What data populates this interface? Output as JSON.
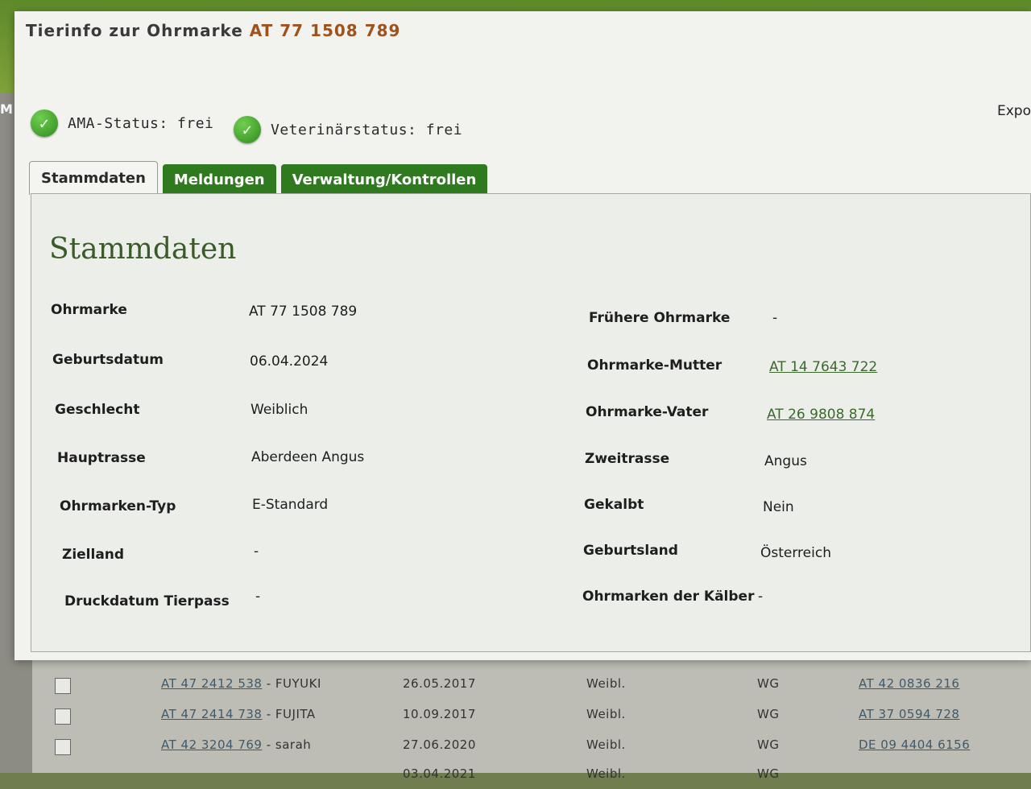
{
  "dialog": {
    "title_prefix": "Tierinfo zur Ohrmarke",
    "title_tag": "AT 77 1508 789",
    "export_label": "Expo"
  },
  "status": {
    "ama": "AMA-Status: frei",
    "vet": "Veterinärstatus: frei"
  },
  "tabs": [
    "Stammdaten",
    "Meldungen",
    "Verwaltung/Kontrollen"
  ],
  "panel": {
    "heading": "Stammdaten",
    "left": [
      {
        "label": "Ohrmarke",
        "value": "AT 77 1508 789"
      },
      {
        "label": "Geburtsdatum",
        "value": "06.04.2024"
      },
      {
        "label": "Geschlecht",
        "value": "Weiblich"
      },
      {
        "label": "Hauptrasse",
        "value": "Aberdeen Angus"
      },
      {
        "label": "Ohrmarken-Typ",
        "value": "E-Standard"
      },
      {
        "label": "Zielland",
        "value": "-"
      },
      {
        "label": "Druckdatum Tierpass",
        "value": "-"
      }
    ],
    "right": [
      {
        "label": "Frühere Ohrmarke",
        "value": "-"
      },
      {
        "label": "Ohrmarke-Mutter",
        "value": "AT 14 7643 722"
      },
      {
        "label": "Ohrmarke-Vater",
        "value": "AT 26 9808 874"
      },
      {
        "label": "Zweitrasse",
        "value": "Angus"
      },
      {
        "label": "Gekalbt",
        "value": "Nein"
      },
      {
        "label": "Geburtsland",
        "value": "Österreich"
      },
      {
        "label": "Ohrmarken der Kälber",
        "value": "-"
      }
    ]
  },
  "background": {
    "left_label": "M",
    "rows": [
      {
        "tag": "AT 47 2412 538",
        "name": " - FUYUKI",
        "date": "26.05.2017",
        "sex": "Weibl.",
        "code": "WG",
        "mother": "AT 42 0836 216"
      },
      {
        "tag": "AT 47 2414 738",
        "name": " - FUJITA",
        "date": "10.09.2017",
        "sex": "Weibl.",
        "code": "WG",
        "mother": "AT 37 0594 728"
      },
      {
        "tag": "AT 42 3204 769",
        "name": " - sarah",
        "date": "27.06.2020",
        "sex": "Weibl.",
        "code": "WG",
        "mother": "DE 09 4404 6156"
      },
      {
        "tag": "",
        "name": "",
        "date": "03.04.2021",
        "sex": "Weibl.",
        "code": "WG",
        "mother": ""
      }
    ]
  }
}
